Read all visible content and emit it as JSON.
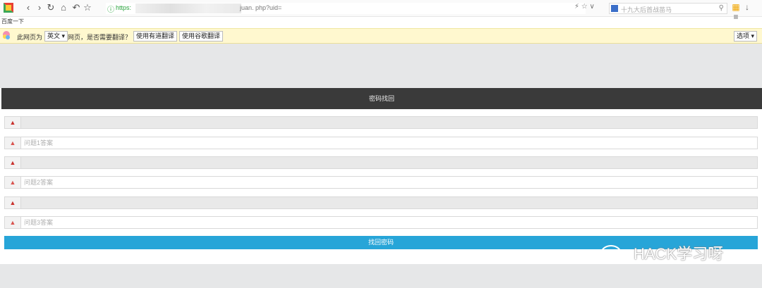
{
  "browser": {
    "url_protocol": "https:",
    "url_path": "juan. php?uid=",
    "search_placeholder": "十九大后首战苗马",
    "bookmark": "百度一下"
  },
  "translate_bar": {
    "prefix": "此网页为",
    "language": "英文 ▾",
    "question": "网页，是否需要翻译？",
    "youdao": "使用有道翻译",
    "google": "使用谷歌翻译",
    "options": "选项 ▾"
  },
  "page": {
    "title": "密码找回",
    "fields": [
      {
        "type": "alert",
        "icon": "warning-icon"
      },
      {
        "type": "input",
        "placeholder": "问题1答案",
        "icon": "thumbs-up-icon"
      },
      {
        "type": "alert",
        "icon": "warning-icon"
      },
      {
        "type": "input",
        "placeholder": "问题2答案",
        "icon": "thumbs-up-icon"
      },
      {
        "type": "alert",
        "icon": "warning-icon"
      },
      {
        "type": "input",
        "placeholder": "问题3答案",
        "icon": "thumbs-up-icon"
      }
    ],
    "submit_label": "找回密码"
  },
  "watermark": "HACK学习呀",
  "colors": {
    "header_bg": "#3a3a3a",
    "submit_bg": "#27a5d8",
    "alert_icon": "#c9302c",
    "translate_bar_bg": "#fff8cf"
  }
}
